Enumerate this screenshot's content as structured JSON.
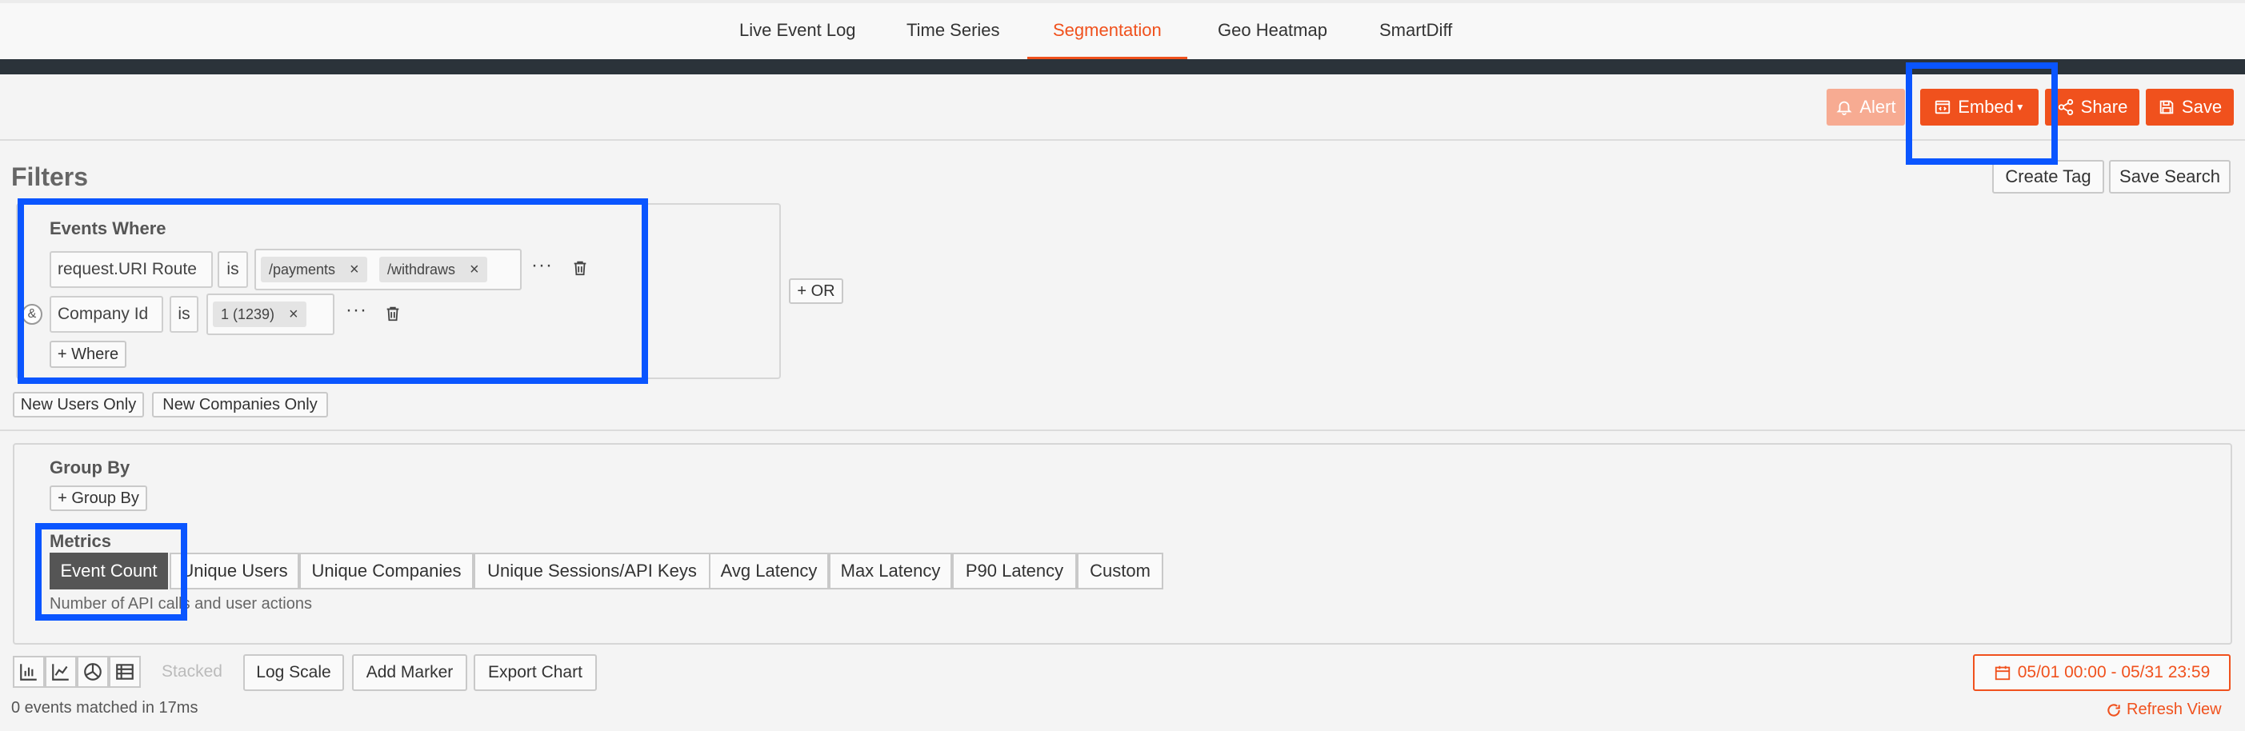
{
  "nav": {
    "tabs": [
      {
        "label": "Live Event Log"
      },
      {
        "label": "Time Series"
      },
      {
        "label": "Segmentation"
      },
      {
        "label": "Geo Heatmap"
      },
      {
        "label": "SmartDiff"
      }
    ],
    "active_tab": "Segmentation"
  },
  "toolbar": {
    "alert_label": "Alert",
    "embed_label": "Embed",
    "share_label": "Share",
    "save_label": "Save",
    "create_tag_label": "Create Tag",
    "save_search_label": "Save Search"
  },
  "filters": {
    "title": "Filters",
    "events_where_label": "Events Where",
    "rows": [
      {
        "field": "request.URI Route",
        "operator": "is",
        "values": [
          "/payments",
          "/withdraws"
        ]
      },
      {
        "field": "Company Id",
        "operator": "is",
        "values": [
          "1 (1239)"
        ]
      }
    ],
    "and_label": "&",
    "add_where_label": "+ Where",
    "or_label": "+ OR",
    "new_users_label": "New Users Only",
    "new_companies_label": "New Companies Only"
  },
  "group_by": {
    "label": "Group By",
    "add_label": "+ Group By"
  },
  "metrics": {
    "label": "Metrics",
    "options": [
      "Event Count",
      "Unique Users",
      "Unique Companies",
      "Unique Sessions/API Keys",
      "Avg Latency",
      "Max Latency",
      "P90 Latency",
      "Custom"
    ],
    "selected": "Event Count",
    "hint": "Number of API calls and user actions"
  },
  "chart_controls": {
    "icons": [
      "bar-chart-icon",
      "line-chart-icon",
      "pie-chart-icon",
      "table-icon"
    ],
    "stacked_label": "Stacked",
    "log_scale_label": "Log Scale",
    "add_marker_label": "Add Marker",
    "export_chart_label": "Export Chart"
  },
  "date_range": "05/01 00:00 - 05/31 23:59",
  "status": "0 events matched in 17ms",
  "refresh_label": "Refresh View",
  "colors": {
    "accent": "#f0511d",
    "accent_disabled": "#f7ab92",
    "highlight": "#0a55ff",
    "dark_bar": "#2b333a",
    "metric_selected": "#555555"
  }
}
